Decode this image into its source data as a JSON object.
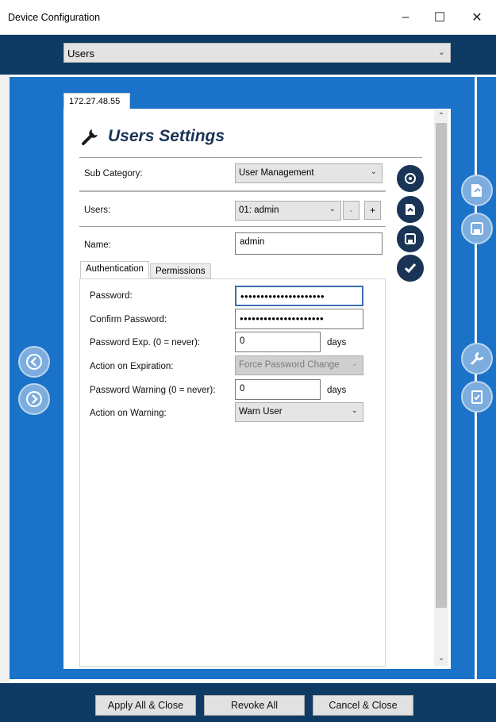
{
  "window": {
    "title": "Device Configuration",
    "minimize": "–",
    "maximize": "☐",
    "close": "✕"
  },
  "category_select": {
    "value": "Users"
  },
  "device_tab": {
    "label": "172.27.48.55"
  },
  "heading": {
    "title": "Users Settings"
  },
  "sub_category": {
    "label": "Sub Category:",
    "value": "User Management"
  },
  "users": {
    "label": "Users:",
    "value": "01: admin",
    "minus": "-",
    "plus": "+"
  },
  "name": {
    "label": "Name:",
    "value": "admin"
  },
  "tabs": [
    {
      "label": "Authentication"
    },
    {
      "label": "Permissions"
    }
  ],
  "auth": {
    "password": {
      "label": "Password:",
      "value": "•••••••••••••••••••••"
    },
    "confirm": {
      "label": "Confirm Password:",
      "value": "•••••••••••••••••••••"
    },
    "pwd_exp": {
      "label": "Password Exp. (0 = never):",
      "value": "0",
      "unit": "days"
    },
    "action_exp": {
      "label": "Action on Expiration:",
      "value": "Force Password Change"
    },
    "pwd_warn": {
      "label": "Password Warning (0 = never):",
      "value": "0",
      "unit": "days"
    },
    "action_warn": {
      "label": "Action on Warning:",
      "value": "Warn User"
    }
  },
  "footer": {
    "apply": "Apply All & Close",
    "revoke": "Revoke All",
    "cancel": "Cancel & Close"
  }
}
